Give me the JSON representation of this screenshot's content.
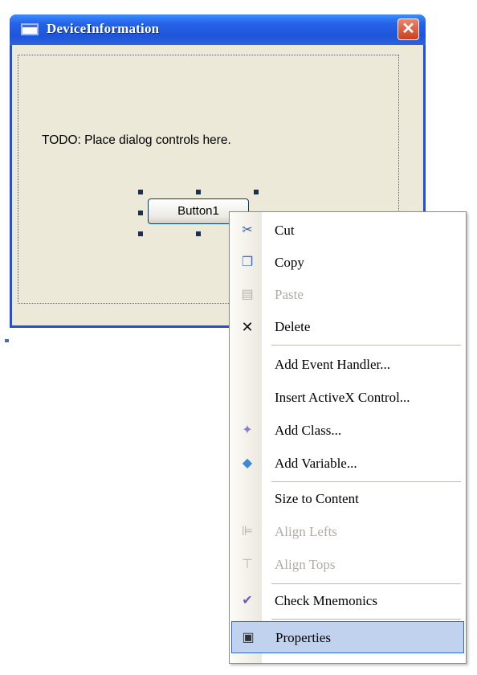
{
  "window": {
    "title": "DeviceInformation",
    "close_glyph": "✕"
  },
  "dialog": {
    "todo_text": "TODO: Place dialog controls here.",
    "button1_label": "Button1"
  },
  "menu": {
    "items": [
      {
        "label": "Cut",
        "icon": "scissors-icon",
        "glyph": "✂",
        "enabled": true
      },
      {
        "label": "Copy",
        "icon": "copy-icon",
        "glyph": "❐",
        "enabled": true
      },
      {
        "label": "Paste",
        "icon": "paste-icon",
        "glyph": "▤",
        "enabled": false
      },
      {
        "label": "Delete",
        "icon": "delete-icon",
        "glyph": "✕",
        "enabled": true
      },
      {
        "label": "Add Event Handler...",
        "icon": "",
        "glyph": "",
        "enabled": true
      },
      {
        "label": "Insert ActiveX Control...",
        "icon": "",
        "glyph": "",
        "enabled": true
      },
      {
        "label": "Add Class...",
        "icon": "add-class-icon",
        "glyph": "✦",
        "enabled": true
      },
      {
        "label": "Add Variable...",
        "icon": "add-variable-icon",
        "glyph": "◆",
        "enabled": true
      },
      {
        "label": "Size to Content",
        "icon": "",
        "glyph": "",
        "enabled": true
      },
      {
        "label": "Align Lefts",
        "icon": "align-lefts-icon",
        "glyph": "⊫",
        "enabled": false
      },
      {
        "label": "Align Tops",
        "icon": "align-tops-icon",
        "glyph": "⊤",
        "enabled": false
      },
      {
        "label": "Check Mnemonics",
        "icon": "check-mnemonics-icon",
        "glyph": "✔",
        "enabled": true
      },
      {
        "label": "Properties",
        "icon": "properties-icon",
        "glyph": "▣",
        "enabled": true,
        "selected": true
      }
    ]
  }
}
